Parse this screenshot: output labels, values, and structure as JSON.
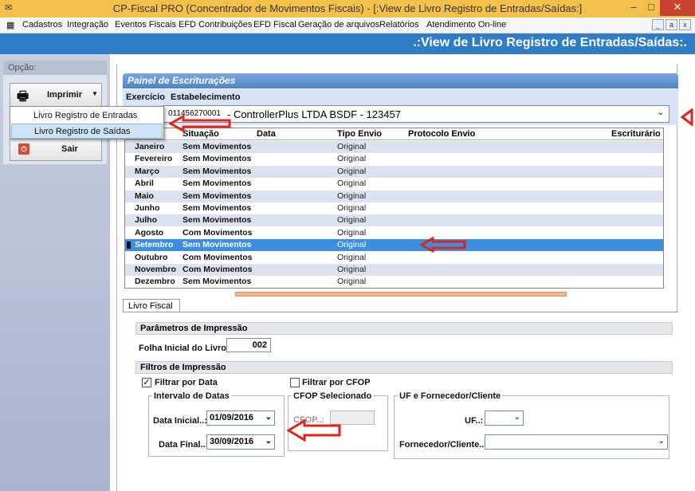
{
  "window": {
    "title": "CP-Fiscal PRO (Concentrador de Movimentos Fiscais) - [:View de Livro Registro de Entradas/Saídas:]",
    "minimize": "–",
    "maximize": "□",
    "close": "✕"
  },
  "menu": [
    "Cadastros",
    "Integração",
    "Eventos Fiscais",
    "EFD Contribuições",
    "EFD Fiscal",
    "Geração de arquivos",
    "Relatórios",
    "Atendimento On-line"
  ],
  "mdi_controls": [
    "_",
    "a",
    "x"
  ],
  "header_title": ".:View de Livro Registro de Entradas/Saídas:.",
  "sidebar": {
    "opcao_label": "Opção:",
    "print_button": "Imprimir",
    "exit_button": "Sair",
    "print_menu": [
      "Livro Registro de Entradas",
      "Livro Registro de Saídas"
    ]
  },
  "panel": {
    "title": "Painel de Escriturações",
    "exercicio_label": "Exercício",
    "estabelecimento_label": "Estabelecimento",
    "estab_code": "011456270001",
    "estab_name": "- ControllerPlus LTDA BSDF - 123457"
  },
  "grid": {
    "columns": [
      "Situação",
      "Data",
      "Tipo Envio",
      "Protocolo Envio",
      "Escriturário"
    ],
    "rows": [
      {
        "mes": "Janeiro",
        "situacao": "Sem Movimentos",
        "tipo": "Original"
      },
      {
        "mes": "Fevereiro",
        "situacao": "Sem Movimentos",
        "tipo": "Original"
      },
      {
        "mes": "Março",
        "situacao": "Sem Movimentos",
        "tipo": "Original"
      },
      {
        "mes": "Abril",
        "situacao": "Sem Movimentos",
        "tipo": "Original"
      },
      {
        "mes": "Maio",
        "situacao": "Sem Movimentos",
        "tipo": "Original"
      },
      {
        "mes": "Junho",
        "situacao": "Sem Movimentos",
        "tipo": "Original"
      },
      {
        "mes": "Julho",
        "situacao": "Sem Movimentos",
        "tipo": "Original"
      },
      {
        "mes": "Agosto",
        "situacao": "Com Movimentos",
        "tipo": "Original"
      },
      {
        "mes": "Setembro",
        "situacao": "Sem Movimentos",
        "tipo": "Original"
      },
      {
        "mes": "Outubro",
        "situacao": "Com Movimentos",
        "tipo": "Original"
      },
      {
        "mes": "Novembro",
        "situacao": "Com Movimentos",
        "tipo": "Original"
      },
      {
        "mes": "Dezembro",
        "situacao": "Sem Movimentos",
        "tipo": "Original"
      }
    ],
    "selected_row": 8
  },
  "tab": "Livro Fiscal",
  "params": {
    "section_title": "Parâmetros de Impressão",
    "folha_label": "Folha Inicial do Livro..:",
    "folha_value": "002"
  },
  "filters": {
    "section_title": "Filtros de Impressão",
    "filtrar_data": "Filtrar por Data",
    "filtrar_cfop": "Filtrar por CFOP",
    "intervalo_title": "Intervalo de Datas",
    "data_inicial_label": "Data Inicial..:",
    "data_inicial": "01/09/2016",
    "data_final_label": "Data Final..:",
    "data_final": "30/09/2016",
    "cfop_title": "CFOP Selecionado",
    "cfop_label": "CFOP..:",
    "uf_group_title": "UF e Fornecedor/Cliente",
    "uf_label": "UF..:",
    "fornecedor_label": "Fornecedor/Cliente..:"
  },
  "colors": {
    "header": "#2f7dc5",
    "titlebar": "#f3c04a",
    "selected": "#3d8ee0",
    "arrow": "#e2231a"
  }
}
